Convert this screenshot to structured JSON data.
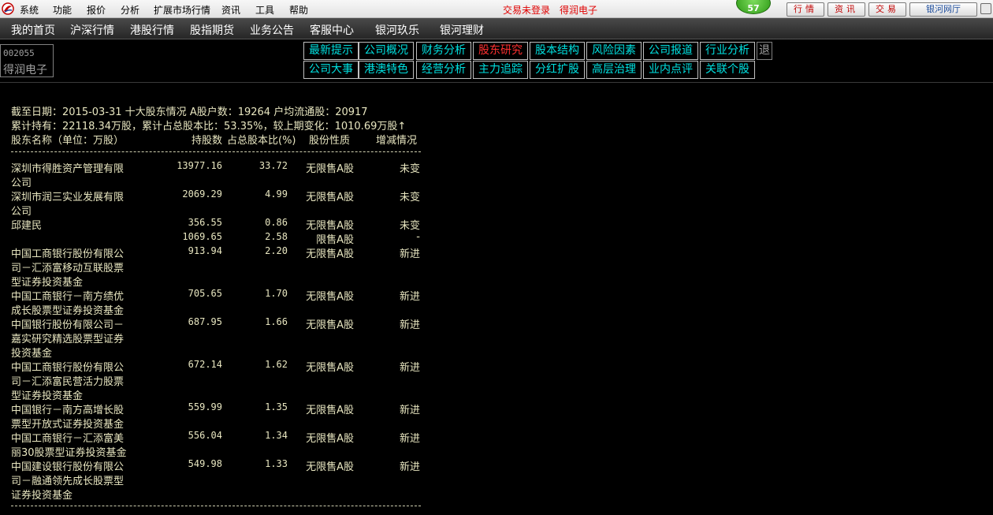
{
  "menubar": {
    "items": [
      "系统",
      "功能",
      "报价",
      "分析",
      "扩展市场行情",
      "资讯",
      "工具",
      "帮助"
    ],
    "status_text": "交易未登录",
    "stock_name": "得润电子",
    "badge_count": "57",
    "buttons": [
      "行情",
      "资讯",
      "交易"
    ],
    "portal_button": "银河网厅"
  },
  "navbar": {
    "items": [
      "我的首页",
      "沪深行情",
      "港股行情",
      "股指期货",
      "业务公告",
      "客服中心",
      "银河玖乐",
      "银河理财"
    ]
  },
  "stock": {
    "code": "002055",
    "name": "得润电子"
  },
  "tabs": {
    "row1": [
      "最新提示",
      "公司概况",
      "财务分析",
      "股东研究",
      "股本结构",
      "风险因素",
      "公司报道",
      "行业分析"
    ],
    "row2": [
      "公司大事",
      "港澳特色",
      "经营分析",
      "主力追踪",
      "分红扩股",
      "高层治理",
      "业内点评",
      "关联个股"
    ],
    "active": "股东研究",
    "exit_label": "退"
  },
  "content": {
    "summary_line1": "截至日期：2015-03-31 十大股东情况 A股户数：19264 户均流通股：20917",
    "summary_line2": "累计持有：22118.34万股，累计占总股本比：53.35%，较上期变化：1010.69万股↑",
    "headers": [
      "股东名称（单位：万股）",
      "持股数",
      "占总股本比(%)",
      "股份性质",
      "增减情况"
    ]
  },
  "holders": [
    {
      "name_lines": [
        "深圳市得胜资产管理有限",
        "公司"
      ],
      "shares": "13977.16",
      "ratio": "33.72",
      "type": "无限售A股",
      "change": "未变"
    },
    {
      "name_lines": [
        "深圳市润三实业发展有限",
        "公司"
      ],
      "shares": "2069.29",
      "ratio": "4.99",
      "type": "无限售A股",
      "change": "未变"
    },
    {
      "name_lines": [
        "邱建民"
      ],
      "shares": "356.55",
      "ratio": "0.86",
      "type": "无限售A股",
      "change": "未变"
    },
    {
      "name_lines": [],
      "shares": "1069.65",
      "ratio": "2.58",
      "type": "限售A股",
      "change": "-"
    },
    {
      "name_lines": [
        "中国工商银行股份有限公",
        "司－汇添富移动互联股票",
        "型证券投资基金"
      ],
      "shares": "913.94",
      "ratio": "2.20",
      "type": "无限售A股",
      "change": "新进"
    },
    {
      "name_lines": [
        "中国工商银行－南方绩优",
        "成长股票型证券投资基金"
      ],
      "shares": "705.65",
      "ratio": "1.70",
      "type": "无限售A股",
      "change": "新进"
    },
    {
      "name_lines": [
        "中国银行股份有限公司－",
        "嘉实研究精选股票型证券",
        "投资基金"
      ],
      "shares": "687.95",
      "ratio": "1.66",
      "type": "无限售A股",
      "change": "新进"
    },
    {
      "name_lines": [
        "中国工商银行股份有限公",
        "司－汇添富民营活力股票",
        "型证券投资基金"
      ],
      "shares": "672.14",
      "ratio": "1.62",
      "type": "无限售A股",
      "change": "新进"
    },
    {
      "name_lines": [
        "中国银行－南方高增长股",
        "票型开放式证券投资基金"
      ],
      "shares": "559.99",
      "ratio": "1.35",
      "type": "无限售A股",
      "change": "新进"
    },
    {
      "name_lines": [
        "中国工商银行－汇添富美",
        "丽30股票型证券投资基金"
      ],
      "shares": "556.04",
      "ratio": "1.34",
      "type": "无限售A股",
      "change": "新进"
    },
    {
      "name_lines": [
        "中国建设银行股份有限公",
        "司－融通领先成长股票型",
        "证券投资基金"
      ],
      "shares": "549.98",
      "ratio": "1.33",
      "type": "无限售A股",
      "change": "新进"
    }
  ]
}
